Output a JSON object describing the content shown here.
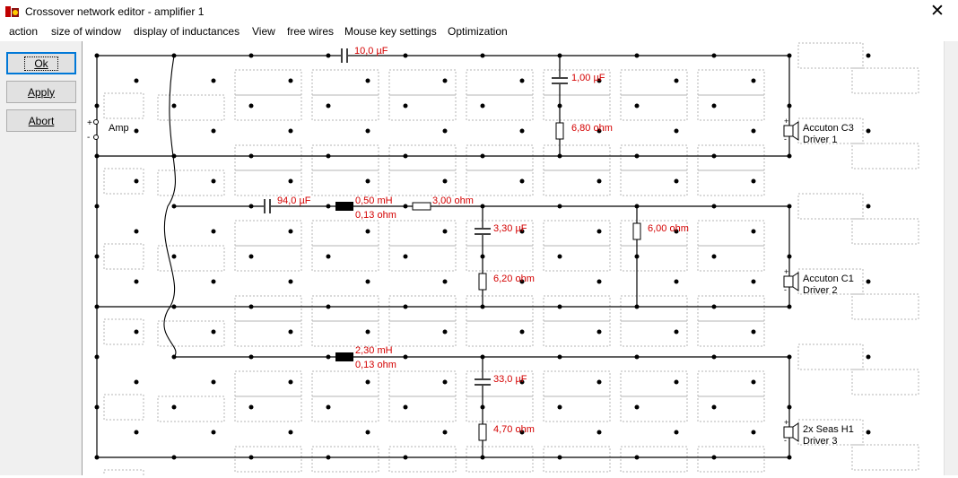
{
  "window": {
    "title": "Crossover network editor - amplifier 1",
    "close_glyph": "✕"
  },
  "menu": [
    "action",
    "size of window",
    "display of inductances",
    "View",
    "free wires",
    "Mouse key settings",
    "Optimization"
  ],
  "buttons": {
    "ok": "Ok",
    "apply": "Apply",
    "abort": "Abort"
  },
  "circuit": {
    "amp_label": "Amp",
    "amp_plus": "+",
    "amp_minus": "-",
    "colors": {
      "value": "#d40000",
      "wire": "#000000",
      "grid": "#b5b5b5"
    },
    "components": {
      "c1": "10,0 µF",
      "c2": "1,00 µF",
      "r1": "6,80 ohm",
      "c3": "94,0 µF",
      "l1": "0,50 mH",
      "l1r": "0,13 ohm",
      "r2": "3,00 ohm",
      "c4": "3,30 µF",
      "r3": "6,00 ohm",
      "r4": "6,20 ohm",
      "l2": "2,30 mH",
      "l2r": "0,13 ohm",
      "c5": "33,0 µF",
      "r5": "4,70 ohm"
    },
    "drivers": [
      {
        "name": "Accuton C3",
        "label": "Driver 1"
      },
      {
        "name": "Accuton C1",
        "label": "Driver 2"
      },
      {
        "name": "2x Seas H1",
        "label": "Driver 3"
      }
    ],
    "driver_plus": "+",
    "driver_minus": "-"
  }
}
